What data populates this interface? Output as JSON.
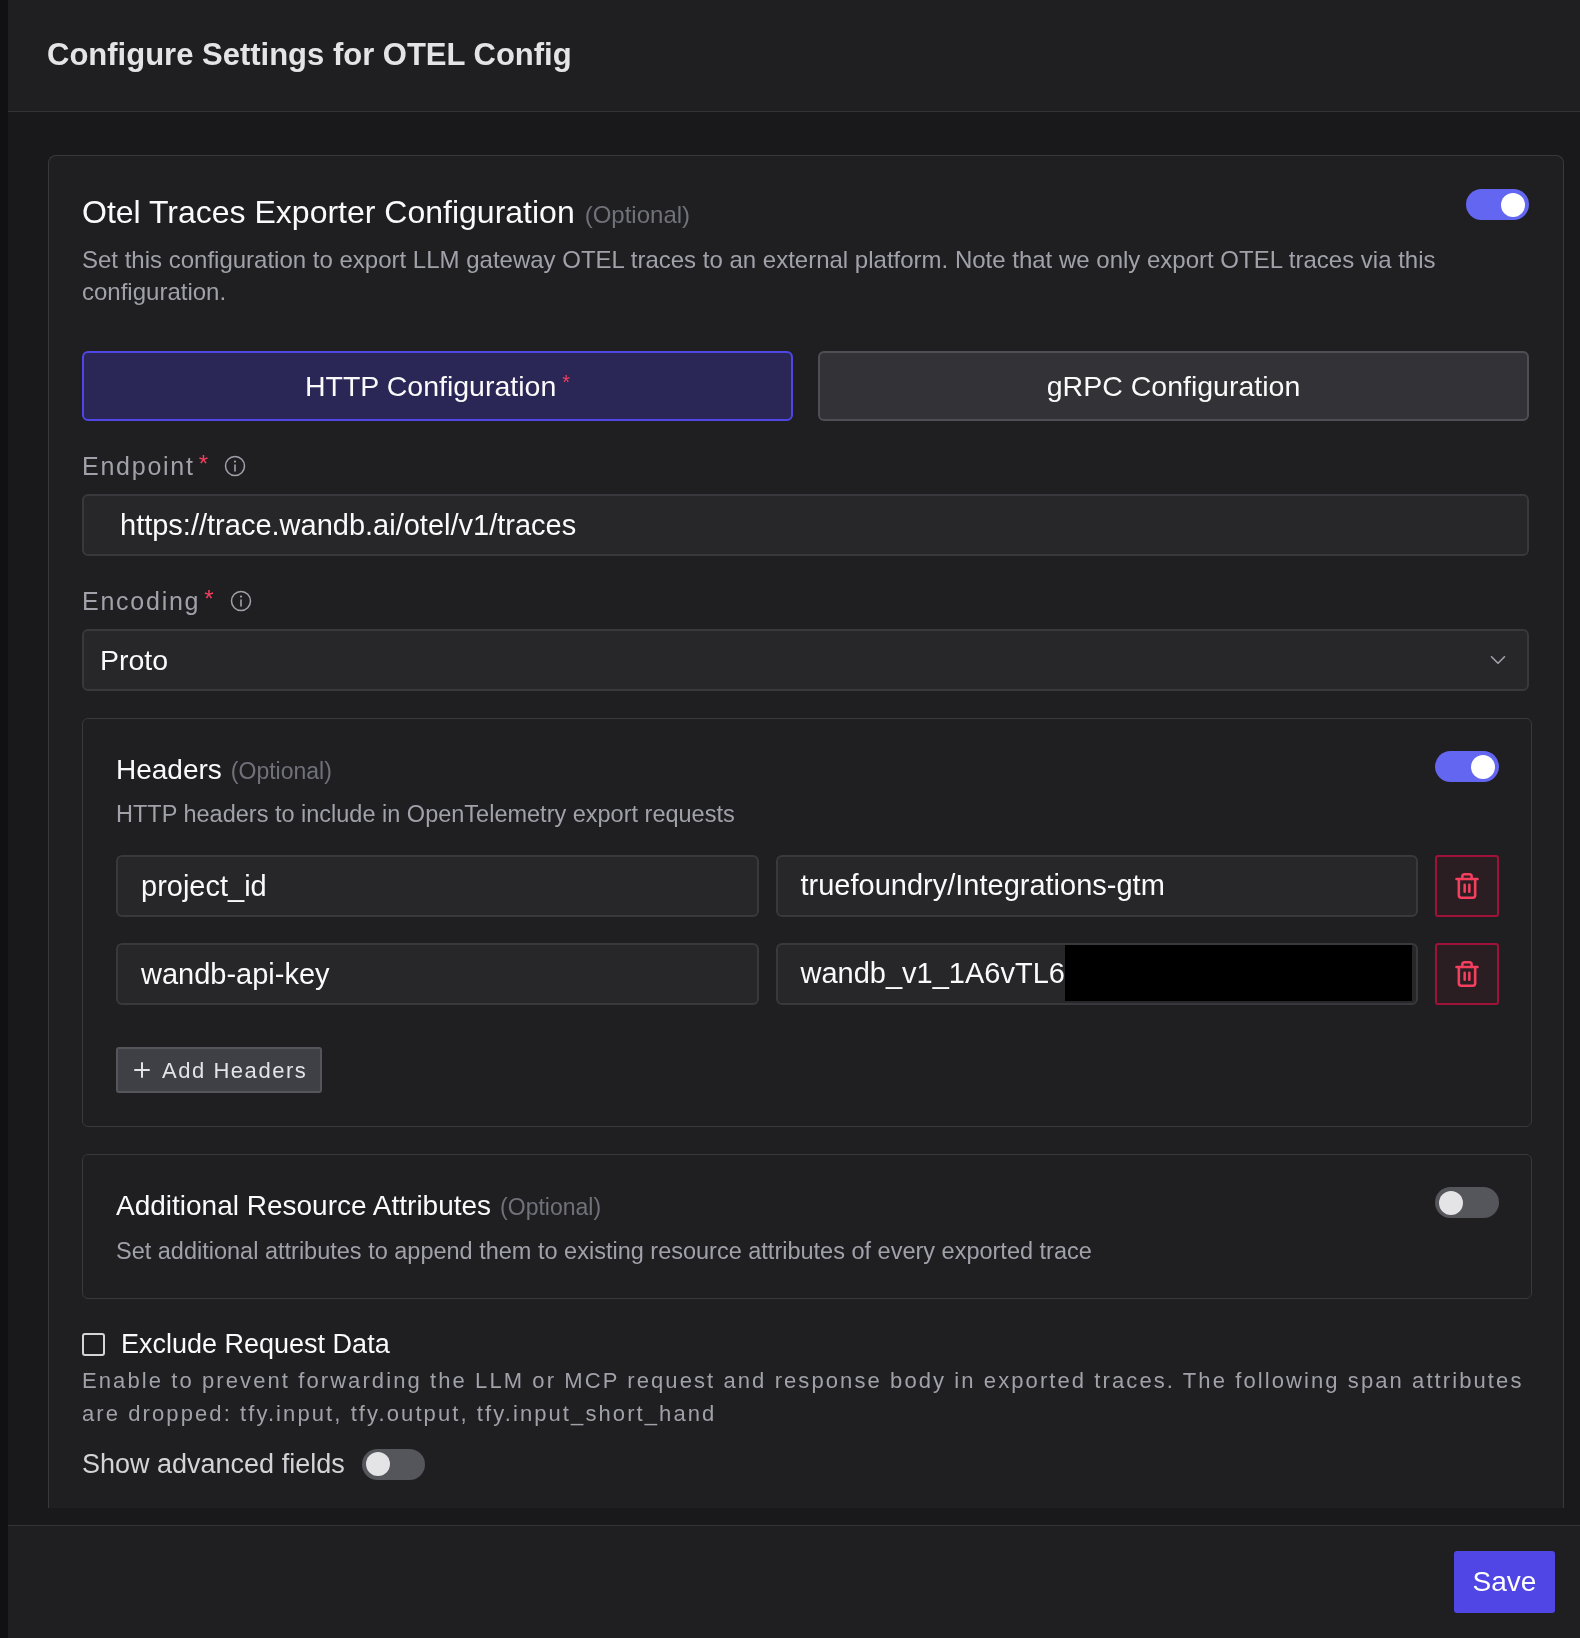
{
  "dialog": {
    "title": "Configure Settings for OTEL Config"
  },
  "exporter": {
    "title": "Otel Traces Exporter Configuration",
    "hint": "(Optional)",
    "enabled": true,
    "description": "Set this configuration to export LLM gateway OTEL traces to an external platform. Note that we only export OTEL traces via this configuration."
  },
  "tabs": [
    {
      "label": "HTTP Configuration",
      "required_mark": "*",
      "selected": true
    },
    {
      "label": "gRPC Configuration",
      "selected": false
    }
  ],
  "fields": [
    {
      "kind": "text",
      "label": "Endpoint",
      "required_mark": "*",
      "value": "https://trace.wandb.ai/otel/v1/traces"
    },
    {
      "kind": "select",
      "label": "Encoding",
      "required_mark": "*",
      "value": "Proto"
    }
  ],
  "headers": {
    "title": "Headers",
    "hint": "(Optional)",
    "enabled": true,
    "description": "HTTP headers to include in OpenTelemetry export requests",
    "rows": [
      {
        "key": "project_id",
        "value": "truefoundry/Integrations-gtm",
        "redacted": false
      },
      {
        "key": "wandb-api-key",
        "value": "wandb_v1_1A6vTL6",
        "redacted": true
      }
    ],
    "add_button": "Add Headers"
  },
  "resource_attributes": {
    "title": "Additional Resource Attributes",
    "hint": "(Optional)",
    "enabled": false,
    "description": "Set additional attributes to append them to existing resource attributes of every exported trace"
  },
  "exclude_request_data": {
    "label": "Exclude Request Data",
    "checked": false,
    "description": "Enable to prevent forwarding the LLM or MCP request and response body in exported traces. The following span attributes are dropped: tfy.input, tfy.output, tfy.input_short_hand"
  },
  "advanced_fields": {
    "label": "Show advanced fields",
    "on": false
  },
  "footer": {
    "save_button": "Save"
  }
}
